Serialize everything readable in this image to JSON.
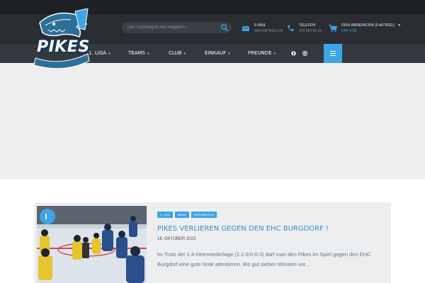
{
  "header": {
    "logo_text": "PIKES",
    "search": {
      "placeholder": "Den Suchbegriff hier eingeben..."
    },
    "email": {
      "label": "E-MAIL",
      "value": "INFO@PIKES.CH"
    },
    "phone": {
      "label": "TELEFON",
      "value": "079 654 50 24"
    },
    "cart": {
      "label": "DEIN WARENKORB (0 ARTIKEL)",
      "value": "CHF 0.00"
    }
  },
  "nav": {
    "items": [
      {
        "label": "1. LIGA"
      },
      {
        "label": "TEAMS"
      },
      {
        "label": "CLUB"
      },
      {
        "label": "EINKAUF"
      },
      {
        "label": "FREUNDE"
      }
    ],
    "social": [
      "facebook-icon",
      "instagram-icon"
    ],
    "menu_icon": "hamburger-icon"
  },
  "article": {
    "tags": [
      "1. LIGA",
      "NEWS",
      "SPIELBERICHT"
    ],
    "title": "PIKES VERLIEREN GEGEN DEN EHC BURGDORF !",
    "date": "16. OKTOBER 2023",
    "excerpt": "hv  Trotz der 1:4-Heimniederlage (1:1-0:0-0:3) darf man den Pikes im Spiel gegen den EHC Burgdorf eine gute Note attestieren. Bis gut sieben Minuten vor..."
  },
  "colors": {
    "accent": "#3ea4e6",
    "header_bg": "#2a2e33",
    "nav_bg": "#33383e",
    "hero_bg": "#eceef0"
  }
}
